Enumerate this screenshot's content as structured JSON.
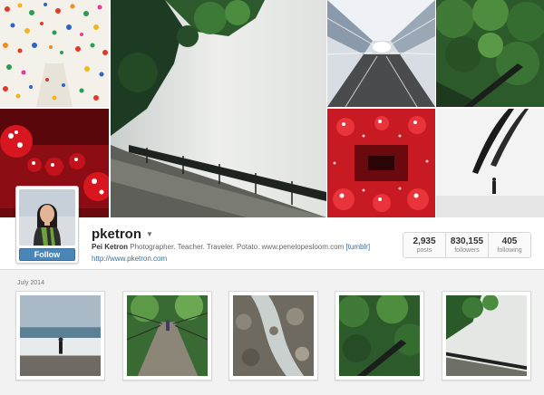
{
  "profile": {
    "username": "pketron",
    "follow_label": "Follow",
    "full_name": "Pei Ketron",
    "bio": "Photographer. Teacher. Traveler. Potato. www.penelopesloom.com",
    "bio_link": "[tumblr]",
    "website": "http://www.pketron.com"
  },
  "stats": [
    {
      "count": "2,935",
      "label": "posts"
    },
    {
      "count": "830,155",
      "label": "followers"
    },
    {
      "count": "405",
      "label": "following"
    }
  ],
  "feed": {
    "month": "July 2014"
  },
  "colors": {
    "link": "#3d6f9c",
    "follow_button": "#4b86b8"
  }
}
